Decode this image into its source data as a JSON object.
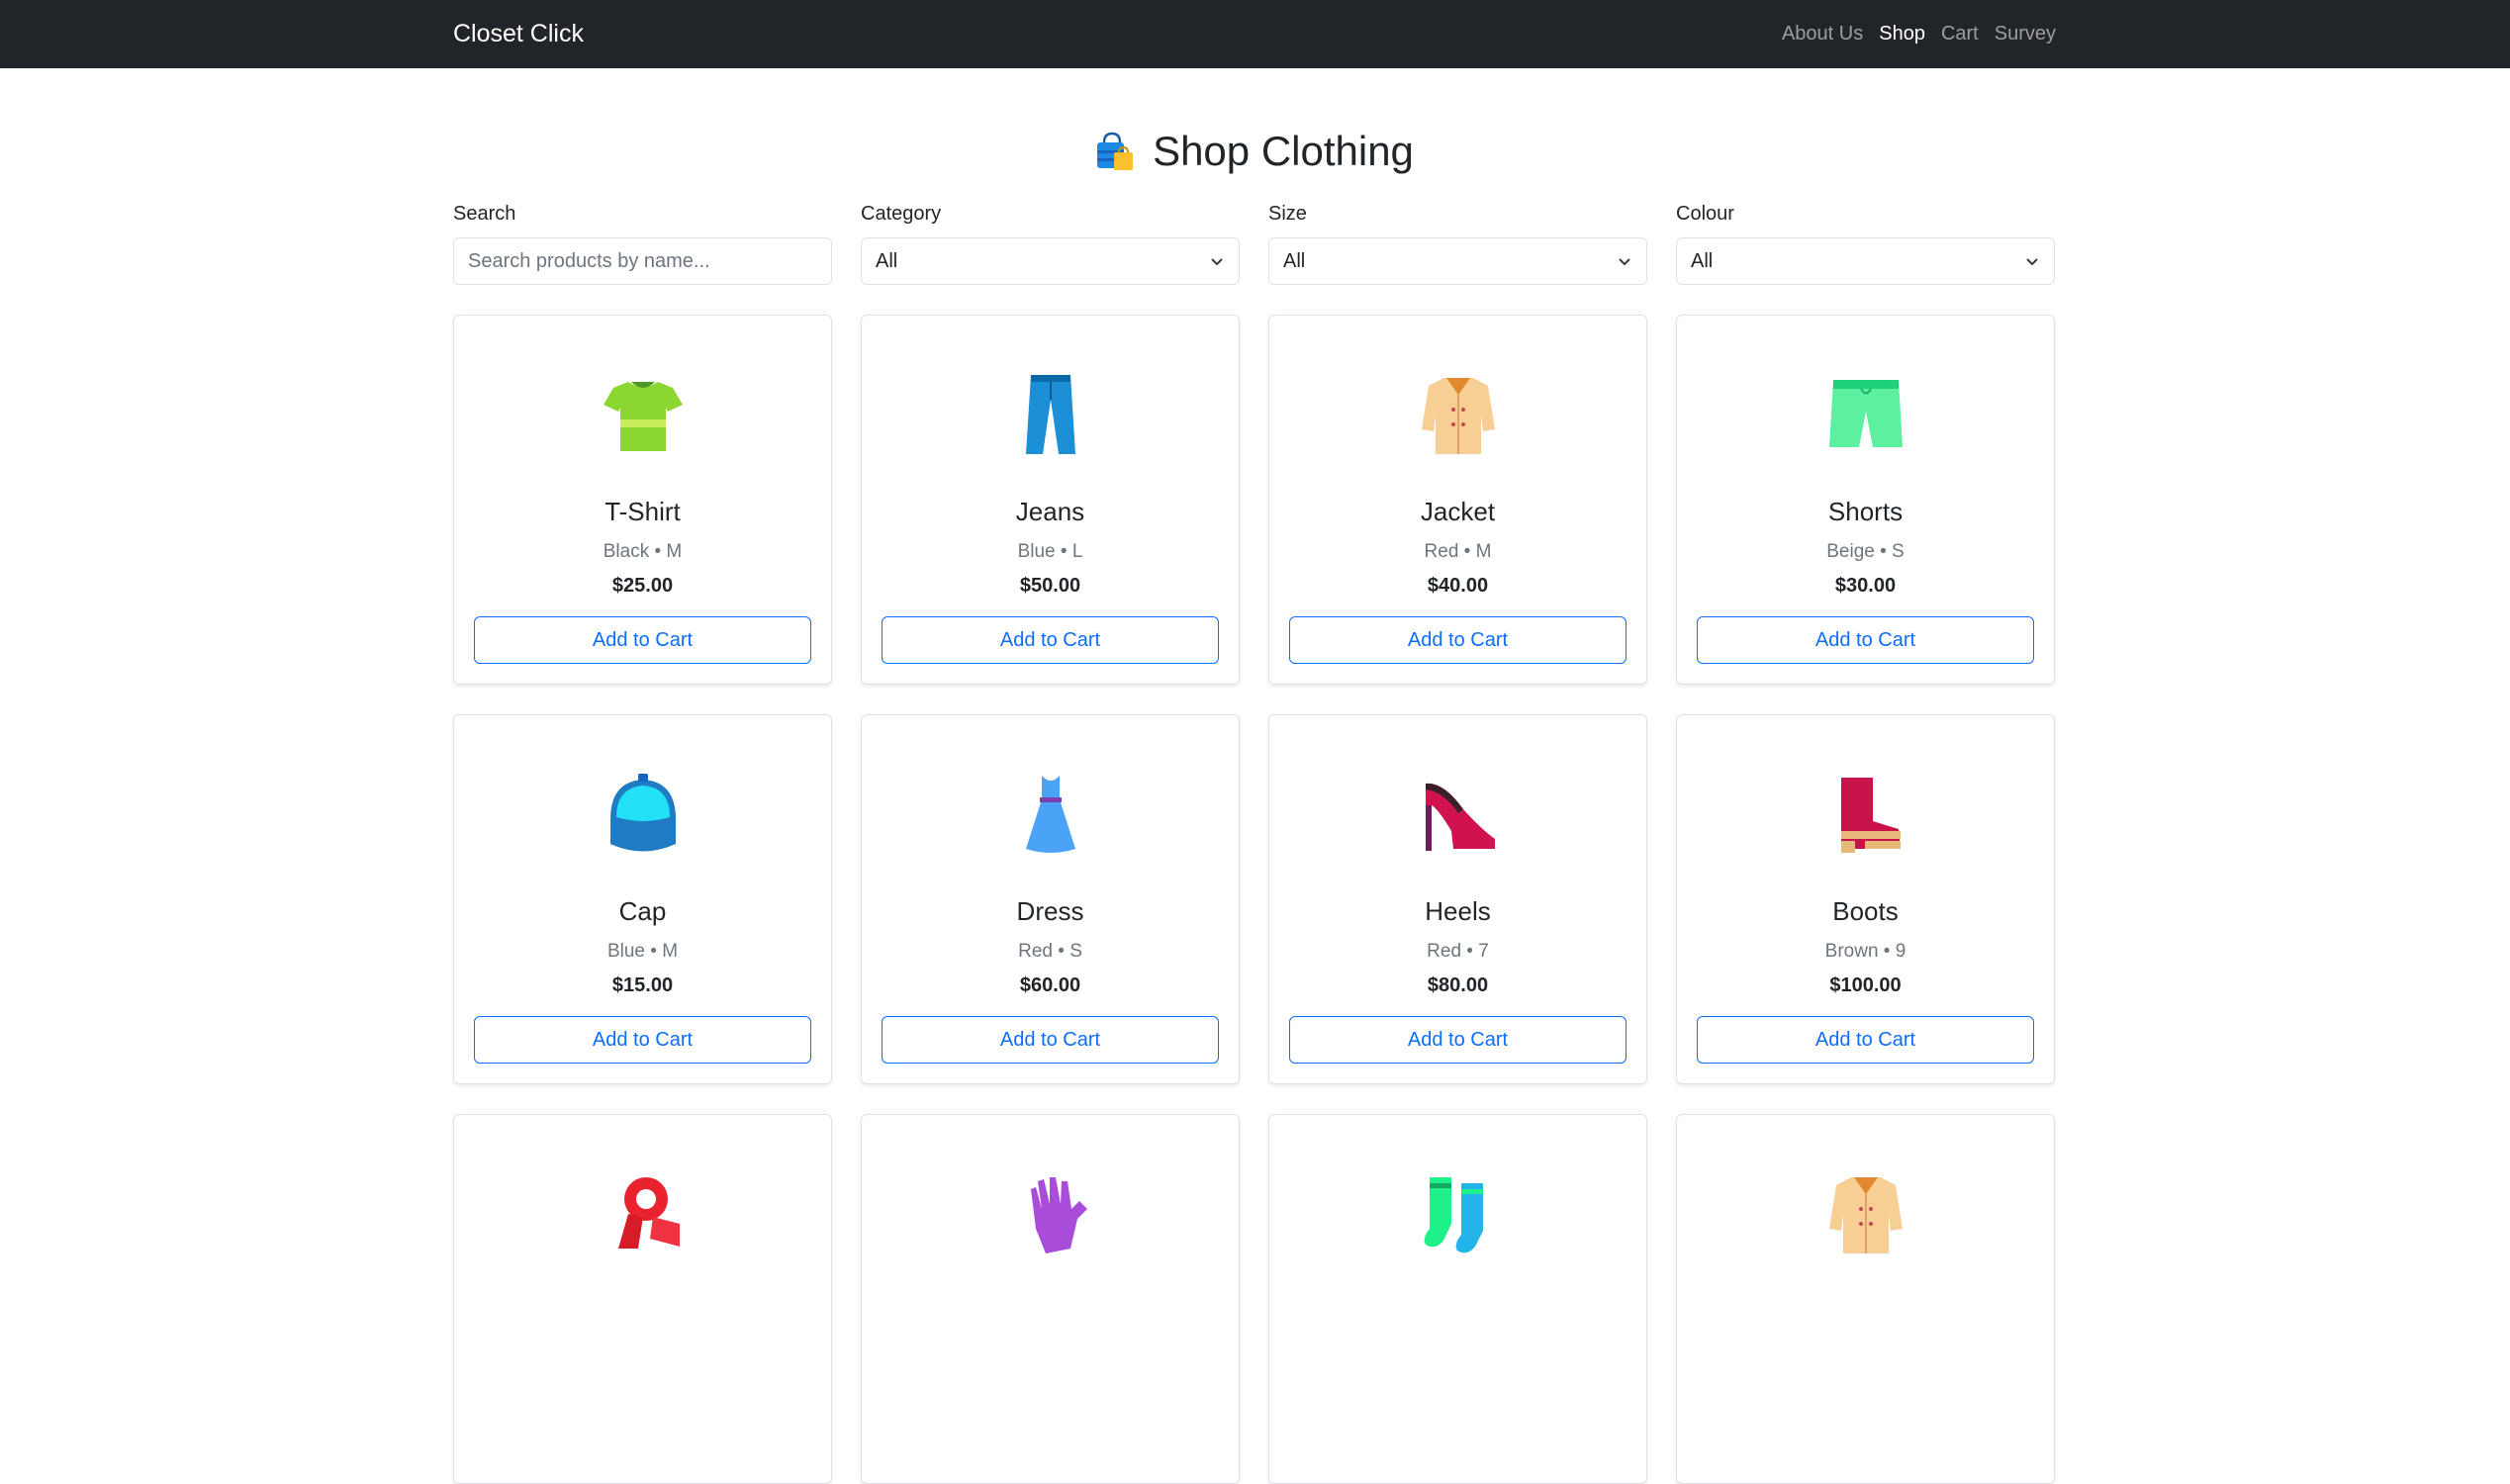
{
  "nav": {
    "brand": "Closet Click",
    "links": [
      "About Us",
      "Shop",
      "Cart",
      "Survey"
    ],
    "active": "Shop"
  },
  "page": {
    "title": "Shop Clothing",
    "title_icon": "shopping-bags-icon"
  },
  "filters": {
    "search": {
      "label": "Search",
      "placeholder": "Search products by name..."
    },
    "category": {
      "label": "Category",
      "value": "All"
    },
    "size": {
      "label": "Size",
      "value": "All"
    },
    "colour": {
      "label": "Colour",
      "value": "All"
    }
  },
  "products": [
    {
      "name": "T-Shirt",
      "meta": "Black • M",
      "price": "$25.00",
      "button": "Add to Cart",
      "icon": "tshirt-icon"
    },
    {
      "name": "Jeans",
      "meta": "Blue • L",
      "price": "$50.00",
      "button": "Add to Cart",
      "icon": "jeans-icon"
    },
    {
      "name": "Jacket",
      "meta": "Red • M",
      "price": "$40.00",
      "button": "Add to Cart",
      "icon": "coat-icon"
    },
    {
      "name": "Shorts",
      "meta": "Beige • S",
      "price": "$30.00",
      "button": "Add to Cart",
      "icon": "shorts-icon"
    },
    {
      "name": "Cap",
      "meta": "Blue • M",
      "price": "$15.00",
      "button": "Add to Cart",
      "icon": "cap-icon"
    },
    {
      "name": "Dress",
      "meta": "Red • S",
      "price": "$60.00",
      "button": "Add to Cart",
      "icon": "dress-icon"
    },
    {
      "name": "Heels",
      "meta": "Red • 7",
      "price": "$80.00",
      "button": "Add to Cart",
      "icon": "heels-icon"
    },
    {
      "name": "Boots",
      "meta": "Brown • 9",
      "price": "$100.00",
      "button": "Add to Cart",
      "icon": "boot-icon"
    },
    {
      "name": "",
      "meta": "",
      "price": "",
      "button": "",
      "icon": "scarf-icon"
    },
    {
      "name": "",
      "meta": "",
      "price": "",
      "button": "",
      "icon": "gloves-icon"
    },
    {
      "name": "",
      "meta": "",
      "price": "",
      "button": "",
      "icon": "socks-icon"
    },
    {
      "name": "",
      "meta": "",
      "price": "",
      "button": "",
      "icon": "coat-icon"
    }
  ]
}
